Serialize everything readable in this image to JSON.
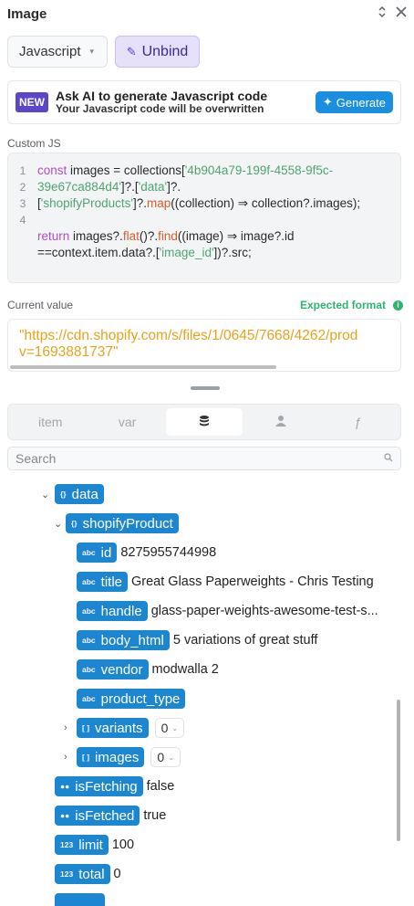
{
  "header": {
    "title": "Image",
    "collapse_icon": "⌃⌄",
    "close_icon": "✕"
  },
  "toolbar": {
    "language": "Javascript",
    "unbind_label": "Unbind"
  },
  "ai": {
    "badge": "NEW",
    "title": "Ask AI to generate Javascript code",
    "subtitle": "Your Javascript code will be overwritten",
    "button_label": "Generate"
  },
  "custom_js": {
    "label": "Custom JS",
    "line_numbers": [
      "1",
      "2",
      "3",
      "4"
    ]
  },
  "current_value": {
    "label": "Current value",
    "expected_label": "Expected format",
    "line1": "\"https://cdn.shopify.com/s/files/1/0645/7668/4262/prod",
    "line2": "v=1693881737\""
  },
  "tabs": {
    "item": "item",
    "var": "var",
    "fn": "ƒ"
  },
  "search": {
    "placeholder": "Search"
  },
  "tree": {
    "data": "data",
    "shopifyProduct": "shopifyProduct",
    "id_key": "id",
    "id_val": "8275955744998",
    "title_key": "title",
    "title_val": "Great Glass Paperweights - Chris Testing",
    "handle_key": "handle",
    "handle_val": "glass-paper-weights-awesome-test-s...",
    "body_key": "body_html",
    "body_val": "5 variations of great stuff",
    "vendor_key": "vendor",
    "vendor_val": "modwalla 2",
    "ptype_key": "product_type",
    "variants_key": "variants",
    "variants_count": "0",
    "images_key": "images",
    "images_count": "0",
    "isFetching_key": "isFetching",
    "isFetching_val": "false",
    "isFetched_key": "isFetched",
    "isFetched_val": "true",
    "limit_key": "limit",
    "limit_val": "100",
    "total_key": "total",
    "total_val": "0",
    "type_obj": "{}",
    "type_arr": "[ ]",
    "type_str": "abc",
    "type_bool": "●●",
    "type_num": "123"
  }
}
